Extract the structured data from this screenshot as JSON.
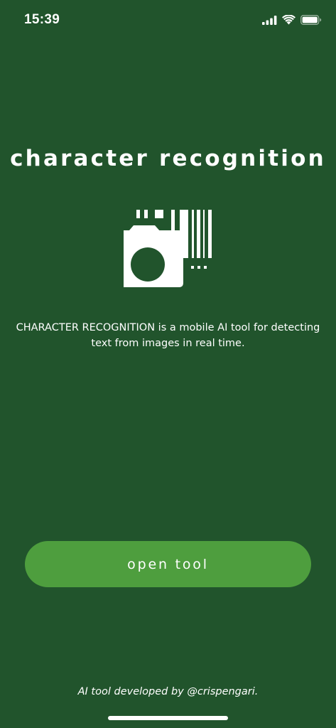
{
  "status_bar": {
    "time": "15:39",
    "icons": [
      "cellular-signal-icon",
      "wifi-icon",
      "battery-icon"
    ]
  },
  "main": {
    "title": "character recognition",
    "logo_icon": "camera-barcode-icon",
    "description": "CHARACTER RECOGNITION is a mobile AI tool for detecting text from images in real time.",
    "button_label": "open tool"
  },
  "footer": {
    "credit": "AI tool developed by @crispengari."
  },
  "colors": {
    "background": "#21542c",
    "button": "#4e9e3e",
    "text": "#ffffff"
  }
}
